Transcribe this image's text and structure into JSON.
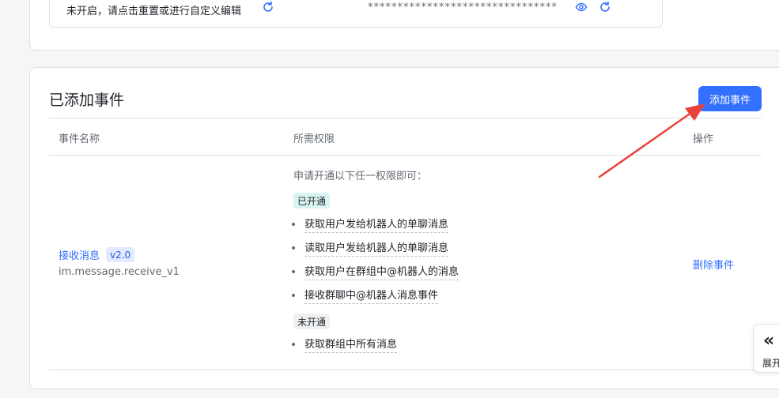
{
  "top_section": {
    "hint_text": "未开启，请点击重置或进行自定义编辑",
    "secret_mask": "********************************"
  },
  "events_card": {
    "title": "已添加事件",
    "add_button_label": "添加事件",
    "columns": {
      "name": "事件名称",
      "permissions": "所需权限",
      "actions": "操作"
    },
    "row": {
      "event_name": "接收消息",
      "version": "v2.0",
      "event_code": "im.message.receive_v1",
      "permission_hint": "申请开通以下任一权限即可：",
      "opened_tag": "已开通",
      "opened_permissions": [
        "获取用户发给机器人的单聊消息",
        "读取用户发给机器人的单聊消息",
        "获取用户在群组中@机器人的消息",
        "接收群聊中@机器人消息事件"
      ],
      "closed_tag": "未开通",
      "closed_permissions": [
        "获取群组中所有消息"
      ],
      "delete_label": "删除事件"
    }
  },
  "side_panel": {
    "chevron": "«",
    "label": "展开"
  },
  "colors": {
    "primary": "#3370ff",
    "annotation_arrow": "#e8433a",
    "opened_tag_bg": "#d9f5f1",
    "closed_tag_bg": "#eff0f1"
  }
}
